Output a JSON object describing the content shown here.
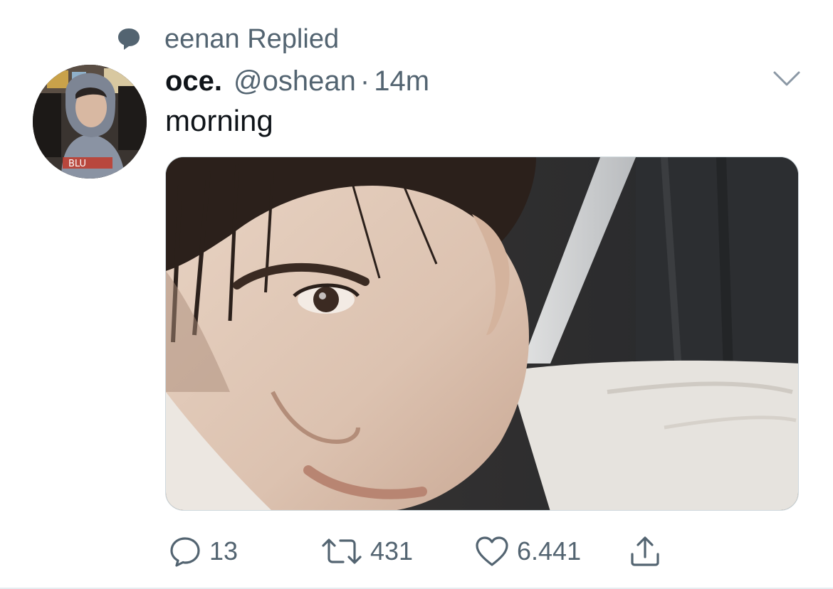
{
  "context": {
    "icon": "speech-bubble-icon",
    "text": "eenan Replied"
  },
  "author": {
    "display_name": "oce.",
    "handle": "@oshean",
    "separator": "·",
    "time": "14m"
  },
  "tweet": {
    "text": "morning"
  },
  "media": {
    "description_icon": "photo"
  },
  "actions": {
    "reply": {
      "icon": "reply-icon",
      "count": "13"
    },
    "retweet": {
      "icon": "retweet-icon",
      "count": "431"
    },
    "like": {
      "icon": "heart-icon",
      "count": "6.441"
    },
    "share": {
      "icon": "share-icon"
    }
  },
  "colors": {
    "secondary_text": "#536471",
    "primary_text": "#0f1419",
    "divider": "#e6ecf0"
  }
}
